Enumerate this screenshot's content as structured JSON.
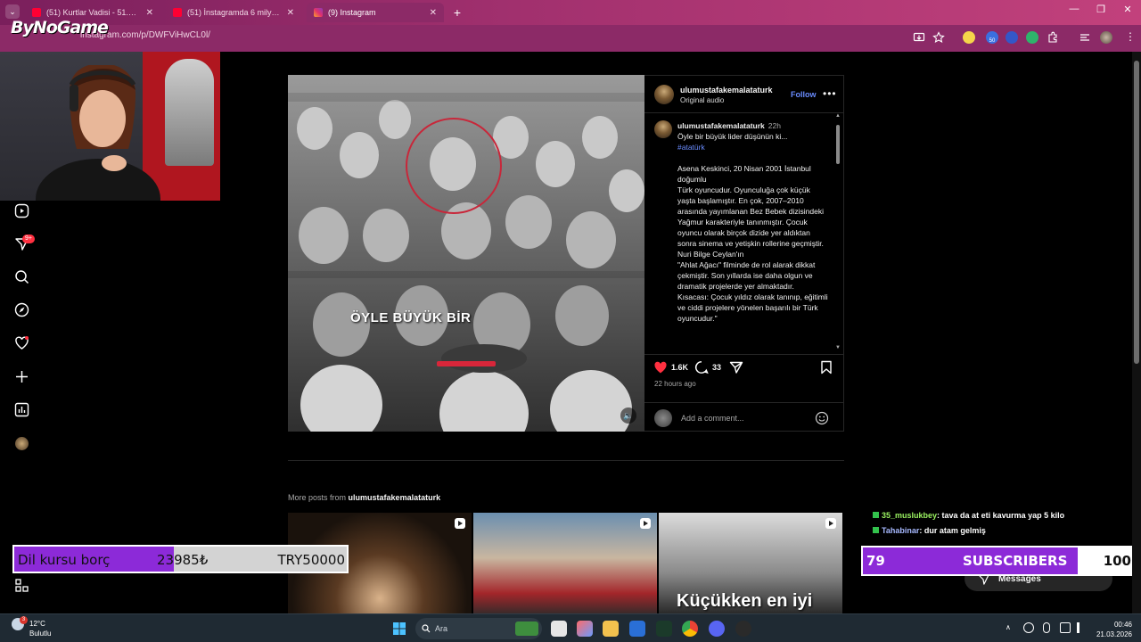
{
  "browser": {
    "tabs": [
      {
        "label": "(51) Kurtlar Vadisi - 51.Bölüm | F",
        "favicon_color": "#ff0033"
      },
      {
        "label": "(51) İnstagramda 6 milyon izlen",
        "favicon_color": "#ff0033"
      },
      {
        "label": "(9) Instagram",
        "favicon_color": "#e1306c"
      }
    ],
    "url": "instagram.com/p/DWFViHwCL0l/",
    "extension_badge": "50",
    "stream_logo": "ByNoGame"
  },
  "sidebar": {
    "icons": [
      "reels-icon",
      "messenger-icon",
      "search-icon",
      "explore-icon",
      "heart-icon",
      "create-icon",
      "dashboard-icon",
      "profile-avatar"
    ],
    "messages_badge": "9+"
  },
  "post": {
    "media_caption": "ÖYLE BÜYÜK BİR",
    "author": "ulumustafakemalataturk",
    "audio": "Original audio",
    "follow_label": "Follow",
    "caption_time": "22h",
    "caption_first": "Öyle bir büyük lider düşünün ki...",
    "hashtag": "#atatürk",
    "caption_body": [
      "Asena Keskinci, 20 Nisan 2001 İstanbul doğumlu",
      "Türk oyuncudur. Oyunculuğa çok küçük yaşta başlamıştır. En çok, 2007–2010 arasında yayımlanan Bez Bebek dizisindeki Yağmur karakteriyle tanınmıştır. Çocuk oyuncu olarak birçok dizide yer aldıktan sonra sinema ve yetişkin rollerine geçmiştir. Nuri Bilge Ceylan'ın",
      "\"Ahlat Ağacı\" filminde de rol alarak dikkat",
      "çekmiştir. Son yıllarda ise daha olgun ve dramatik projelerde yer almaktadır.",
      "Kısacası: Çocuk yıldız olarak tanınıp, eğitimli ve ciddi projelere yönelen başarılı bir Türk oyuncudur.\""
    ],
    "likes": "1.6K",
    "comments": "33",
    "time_ago": "22 hours ago",
    "add_comment_placeholder": "Add a comment...",
    "like_color": "#ff3040"
  },
  "more_posts": {
    "prefix": "More posts from",
    "user": "ulumustafakemalataturk",
    "tiles": [
      {
        "caption": ""
      },
      {
        "caption": ""
      },
      {
        "caption": "Küçükken en iyi"
      }
    ]
  },
  "overlays": {
    "goal_label": "Dil kursu borç",
    "goal_current": "23985₺",
    "goal_target": "TRY50000",
    "goal_fraction": 0.48,
    "subs_current": "79",
    "subs_label": "SUBSCRIBERS",
    "subs_target": "100",
    "subs_fraction": 0.79,
    "chat": [
      {
        "user": "35_muslukbey",
        "text": ": tava da at eti kavurma yap 5 kilo"
      },
      {
        "user": "Tahabinar",
        "text": ": dur atam gelmiş"
      }
    ],
    "messages_label": "Messages"
  },
  "taskbar": {
    "weather_temp": "12°C",
    "weather_desc": "Bulutlu",
    "weather_badge": "3",
    "search_placeholder": "Ara",
    "time": "00:46",
    "date": "21.03.2026"
  }
}
